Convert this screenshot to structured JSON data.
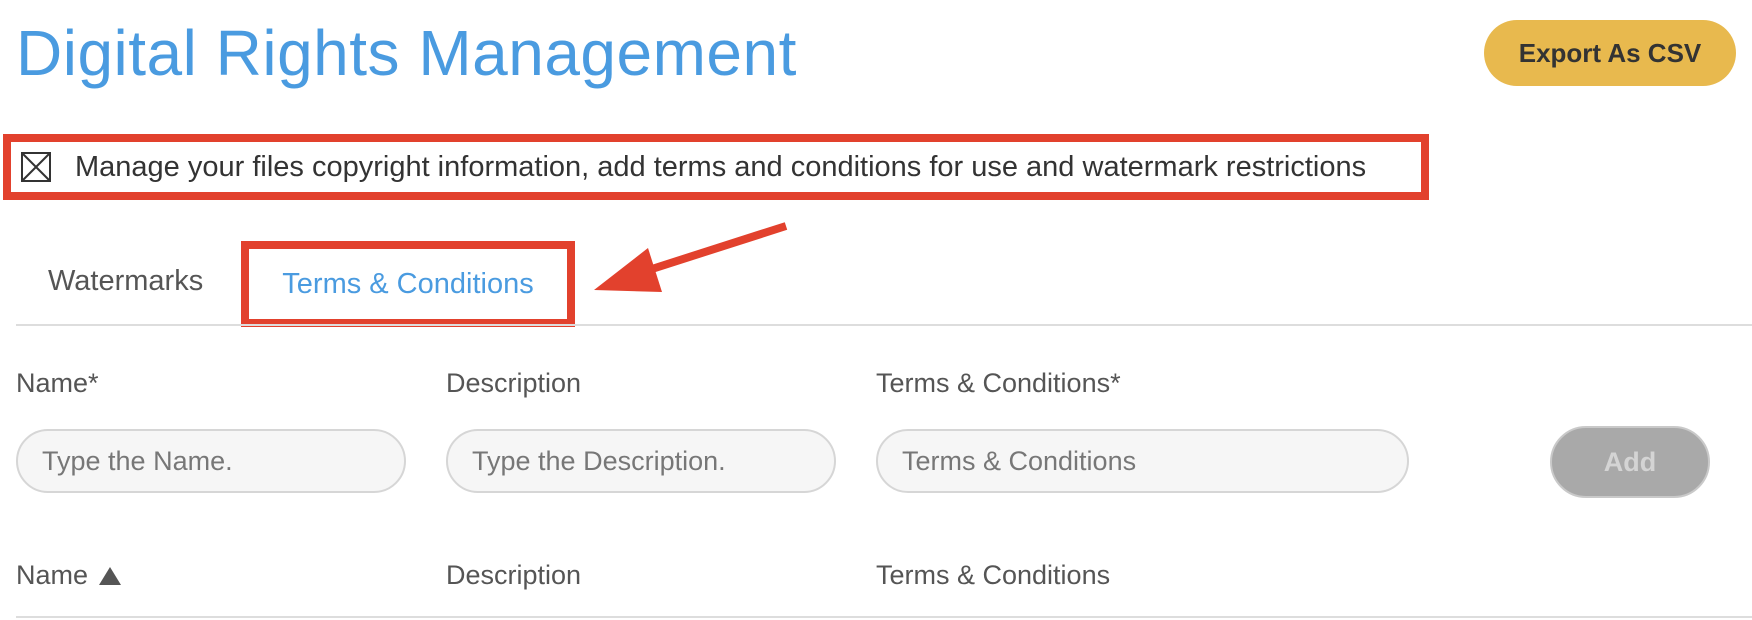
{
  "header": {
    "title": "Digital Rights Management",
    "export_label": "Export As CSV"
  },
  "banner": {
    "icon": "close-box-icon",
    "text": "Manage your files copyright information, add terms and conditions for use and watermark restrictions"
  },
  "tabs": [
    {
      "label": "Watermarks",
      "active": false
    },
    {
      "label": "Terms & Conditions",
      "active": true
    }
  ],
  "form": {
    "name_label": "Name*",
    "name_placeholder": "Type the Name.",
    "description_label": "Description",
    "description_placeholder": "Type the Description.",
    "terms_label": "Terms & Conditions*",
    "terms_placeholder": "Terms & Conditions",
    "add_label": "Add"
  },
  "table": {
    "columns": [
      "Name",
      "Description",
      "Terms & Conditions"
    ],
    "sort_icon": "sort-up-icon"
  },
  "colors": {
    "accent_blue": "#4a9be0",
    "export_gold": "#e8b94e",
    "annotation_red": "#e2412d",
    "disabled_gray": "#a9a9a9"
  }
}
